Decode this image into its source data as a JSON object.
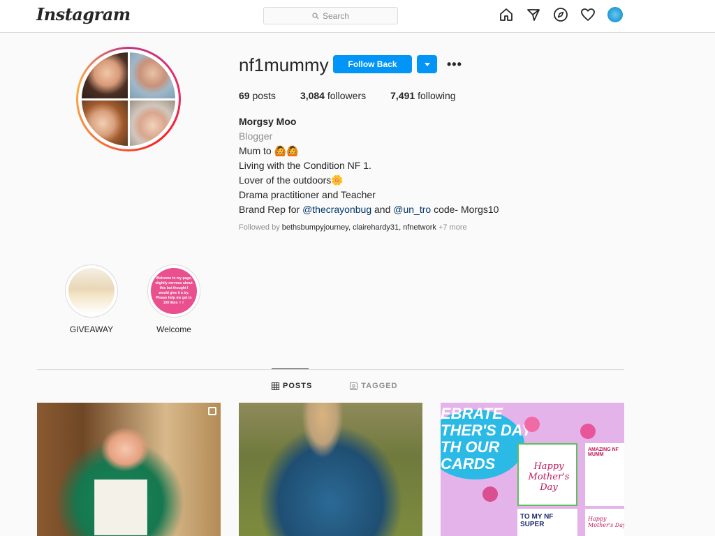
{
  "header": {
    "logo": "Instagram",
    "search_placeholder": "Search",
    "icons": [
      "home-icon",
      "direct-icon",
      "explore-icon",
      "activity-icon",
      "profile-avatar"
    ]
  },
  "profile": {
    "username": "nf1mummy",
    "follow_button": "Follow Back",
    "more": "•••",
    "stats": {
      "posts_count": "69",
      "posts_label": "posts",
      "followers_count": "3,084",
      "followers_label": "followers",
      "following_count": "7,491",
      "following_label": "following"
    },
    "bio": {
      "name": "Morgsy Moo",
      "category": "Blogger",
      "line1": "Mum to 🙆🙆",
      "line2": "Living with the Condition NF 1.",
      "line3": "Lover of the outdoors🌼",
      "line4": "Drama practitioner and Teacher",
      "line5_prefix": "Brand Rep for ",
      "line5_link1": "@thecrayonbug",
      "line5_mid": " and ",
      "line5_link2": "@un_tro",
      "line5_suffix": " code- Morgs10"
    },
    "followed_by": {
      "prefix": "Followed by ",
      "users": "bethsbumpyjourney, clairehardy31, nfnetwork",
      "more": " +7 more"
    }
  },
  "highlights": [
    {
      "label": "GIVEAWAY"
    },
    {
      "label": "Welcome",
      "text": "Welcome to my page, slightly nervous about this but thought I would give it a try. Please help me get to 100 likes ✌✌"
    }
  ],
  "tabs": {
    "posts": "POSTS",
    "tagged": "TAGGED"
  },
  "posts": {
    "p3_banner": "EBRATE\nTHER'S DAY\nTH OUR\nCARDS",
    "p3_card1": "Happy Mother's Day",
    "p3_card2": "AMAZING NF MUMM",
    "p3_card3": "TO MY NF SUPER",
    "p3_card4": "Happy Mother's Day"
  }
}
